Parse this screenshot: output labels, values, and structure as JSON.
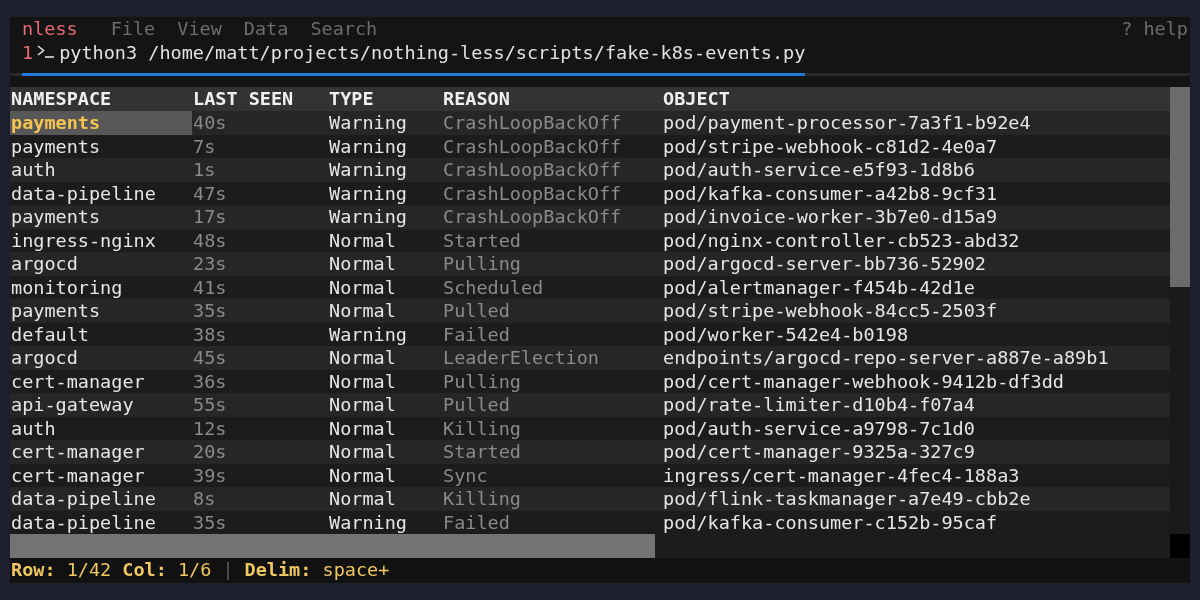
{
  "app": {
    "name": "nless",
    "menu": [
      "File",
      "View",
      "Data",
      "Search"
    ],
    "help": "? help"
  },
  "tabs": [
    {
      "number": "1",
      "command": "python3 /home/matt/projects/nothing-less/scripts/fake-k8s-events.py",
      "selected": true
    }
  ],
  "table": {
    "columns": [
      "NAMESPACE",
      "LAST SEEN",
      "TYPE",
      "REASON",
      "OBJECT"
    ],
    "rows": [
      {
        "cells": [
          {
            "text": "payments",
            "selected": true
          },
          {
            "text": "40s",
            "selected": false
          },
          {
            "text": "Warning",
            "selected": false
          },
          {
            "text": "CrashLoopBackOff",
            "selected": false
          },
          {
            "text": "pod/payment-processor-7a3f1-b92e4",
            "selected": false
          }
        ]
      },
      {
        "cells": [
          {
            "text": "payments",
            "selected": false
          },
          {
            "text": "7s",
            "selected": false
          },
          {
            "text": "Warning",
            "selected": false
          },
          {
            "text": "CrashLoopBackOff",
            "selected": false
          },
          {
            "text": "pod/stripe-webhook-c81d2-4e0a7",
            "selected": false
          }
        ]
      },
      {
        "cells": [
          {
            "text": "auth",
            "selected": false
          },
          {
            "text": "1s",
            "selected": false
          },
          {
            "text": "Warning",
            "selected": false
          },
          {
            "text": "CrashLoopBackOff",
            "selected": false
          },
          {
            "text": "pod/auth-service-e5f93-1d8b6",
            "selected": false
          }
        ]
      },
      {
        "cells": [
          {
            "text": "data-pipeline",
            "selected": false
          },
          {
            "text": "47s",
            "selected": false
          },
          {
            "text": "Warning",
            "selected": false
          },
          {
            "text": "CrashLoopBackOff",
            "selected": false
          },
          {
            "text": "pod/kafka-consumer-a42b8-9cf31",
            "selected": false
          }
        ]
      },
      {
        "cells": [
          {
            "text": "payments",
            "selected": false
          },
          {
            "text": "17s",
            "selected": false
          },
          {
            "text": "Warning",
            "selected": false
          },
          {
            "text": "CrashLoopBackOff",
            "selected": false
          },
          {
            "text": "pod/invoice-worker-3b7e0-d15a9",
            "selected": false
          }
        ]
      },
      {
        "cells": [
          {
            "text": "ingress-nginx",
            "selected": false
          },
          {
            "text": "48s",
            "selected": false
          },
          {
            "text": "Normal",
            "selected": false
          },
          {
            "text": "Started",
            "selected": false
          },
          {
            "text": "pod/nginx-controller-cb523-abd32",
            "selected": false
          }
        ]
      },
      {
        "cells": [
          {
            "text": "argocd",
            "selected": false
          },
          {
            "text": "23s",
            "selected": false
          },
          {
            "text": "Normal",
            "selected": false
          },
          {
            "text": "Pulling",
            "selected": false
          },
          {
            "text": "pod/argocd-server-bb736-52902",
            "selected": false
          }
        ]
      },
      {
        "cells": [
          {
            "text": "monitoring",
            "selected": false
          },
          {
            "text": "41s",
            "selected": false
          },
          {
            "text": "Normal",
            "selected": false
          },
          {
            "text": "Scheduled",
            "selected": false
          },
          {
            "text": "pod/alertmanager-f454b-42d1e",
            "selected": false
          }
        ]
      },
      {
        "cells": [
          {
            "text": "payments",
            "selected": false
          },
          {
            "text": "35s",
            "selected": false
          },
          {
            "text": "Normal",
            "selected": false
          },
          {
            "text": "Pulled",
            "selected": false
          },
          {
            "text": "pod/stripe-webhook-84cc5-2503f",
            "selected": false
          }
        ]
      },
      {
        "cells": [
          {
            "text": "default",
            "selected": false
          },
          {
            "text": "38s",
            "selected": false
          },
          {
            "text": "Warning",
            "selected": false
          },
          {
            "text": "Failed",
            "selected": false
          },
          {
            "text": "pod/worker-542e4-b0198",
            "selected": false
          }
        ]
      },
      {
        "cells": [
          {
            "text": "argocd",
            "selected": false
          },
          {
            "text": "45s",
            "selected": false
          },
          {
            "text": "Normal",
            "selected": false
          },
          {
            "text": "LeaderElection",
            "selected": false
          },
          {
            "text": "endpoints/argocd-repo-server-a887e-a89b1",
            "selected": false
          }
        ]
      },
      {
        "cells": [
          {
            "text": "cert-manager",
            "selected": false
          },
          {
            "text": "36s",
            "selected": false
          },
          {
            "text": "Normal",
            "selected": false
          },
          {
            "text": "Pulling",
            "selected": false
          },
          {
            "text": "pod/cert-manager-webhook-9412b-df3dd",
            "selected": false
          }
        ]
      },
      {
        "cells": [
          {
            "text": "api-gateway",
            "selected": false
          },
          {
            "text": "55s",
            "selected": false
          },
          {
            "text": "Normal",
            "selected": false
          },
          {
            "text": "Pulled",
            "selected": false
          },
          {
            "text": "pod/rate-limiter-d10b4-f07a4",
            "selected": false
          }
        ]
      },
      {
        "cells": [
          {
            "text": "auth",
            "selected": false
          },
          {
            "text": "12s",
            "selected": false
          },
          {
            "text": "Normal",
            "selected": false
          },
          {
            "text": "Killing",
            "selected": false
          },
          {
            "text": "pod/auth-service-a9798-7c1d0",
            "selected": false
          }
        ]
      },
      {
        "cells": [
          {
            "text": "cert-manager",
            "selected": false
          },
          {
            "text": "20s",
            "selected": false
          },
          {
            "text": "Normal",
            "selected": false
          },
          {
            "text": "Started",
            "selected": false
          },
          {
            "text": "pod/cert-manager-9325a-327c9",
            "selected": false
          }
        ]
      },
      {
        "cells": [
          {
            "text": "cert-manager",
            "selected": false
          },
          {
            "text": "39s",
            "selected": false
          },
          {
            "text": "Normal",
            "selected": false
          },
          {
            "text": "Sync",
            "selected": false
          },
          {
            "text": "ingress/cert-manager-4fec4-188a3",
            "selected": false
          }
        ]
      },
      {
        "cells": [
          {
            "text": "data-pipeline",
            "selected": false
          },
          {
            "text": "8s",
            "selected": false
          },
          {
            "text": "Normal",
            "selected": false
          },
          {
            "text": "Killing",
            "selected": false
          },
          {
            "text": "pod/flink-taskmanager-a7e49-cbb2e",
            "selected": false
          }
        ]
      },
      {
        "cells": [
          {
            "text": "data-pipeline",
            "selected": false
          },
          {
            "text": "35s",
            "selected": false
          },
          {
            "text": "Warning",
            "selected": false
          },
          {
            "text": "Failed",
            "selected": false
          },
          {
            "text": "pod/kafka-consumer-c152b-95caf",
            "selected": false
          }
        ]
      }
    ]
  },
  "status_bar": {
    "segments": [
      {
        "kind": "field",
        "label": "Row:",
        "value": "1/42"
      },
      {
        "kind": "field",
        "label": "Col:",
        "value": "1/6"
      },
      {
        "kind": "separator",
        "text": "|"
      },
      {
        "kind": "field",
        "label": "Delim:",
        "value": "space+"
      }
    ]
  }
}
